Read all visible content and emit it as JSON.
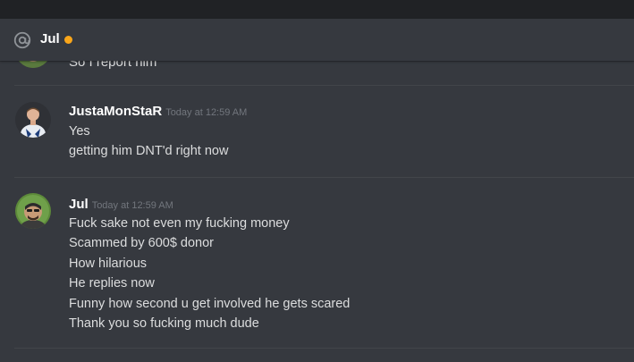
{
  "header": {
    "name": "Jul",
    "status_color": "#faa61a",
    "icon": "at-icon"
  },
  "partial_message": {
    "text": "So I report him"
  },
  "messages": [
    {
      "username": "JustaMonStaR",
      "timestamp": "Today at 12:59 AM",
      "avatar": "avatar-justamonstar",
      "lines": [
        "Yes",
        "getting him DNT'd right now"
      ]
    },
    {
      "username": "Jul",
      "timestamp": "Today at 12:59 AM",
      "avatar": "avatar-jul",
      "lines": [
        "Fuck sake not even my fucking money",
        "Scammed by 600$ donor",
        "How hilarious",
        "He replies now",
        "Funny how second u get involved he gets scared",
        "Thank you so fucking much dude"
      ]
    }
  ]
}
